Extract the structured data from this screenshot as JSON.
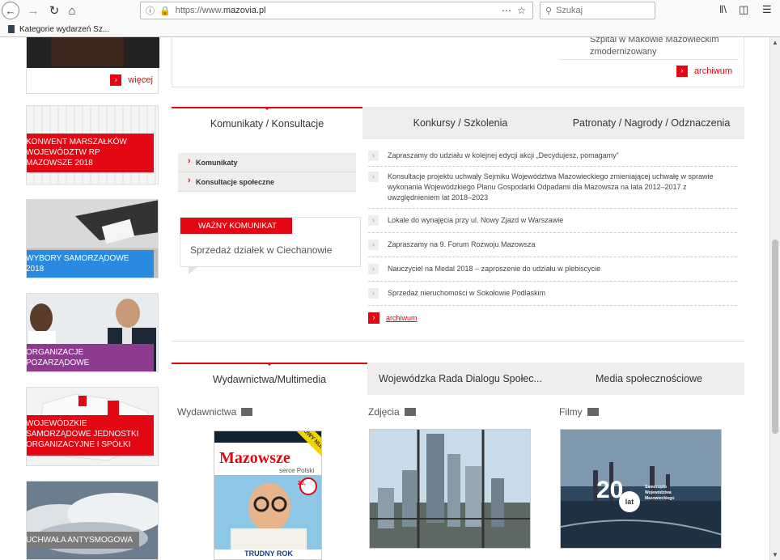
{
  "browser": {
    "url_proto": "https://www.",
    "url_host": "mazovia.pl",
    "search_placeholder": "Szukaj",
    "bookmark": "Kategorie wydarzeń Sz..."
  },
  "top": {
    "more_label": "więcej",
    "news_tail": "Szpital w Makowie Mazowieckim zmodernizowany",
    "archive_label": "archiwum"
  },
  "left_tiles": [
    {
      "label": "KONWENT MARSZAŁKÓW WOJEWÓDZTW RP MAZOWSZE 2018"
    },
    {
      "label": "WYBORY SAMORZĄDOWE 2018"
    },
    {
      "label": "ORGANIZACJE POZARZĄDOWE"
    },
    {
      "label": "WOJEWÓDZKIE SAMORZĄDOWE JEDNOSTKI ORGANIZACYJNE I SPÓŁKI"
    },
    {
      "label": "UCHWAŁA ANTYSMOGOWA"
    }
  ],
  "komunikaty": {
    "tabs": [
      "Komunikaty / Konsultacje",
      "Konkursy / Szkolenia",
      "Patronaty / Nagrody / Odznaczenia"
    ],
    "sub_links": [
      "Komunikaty",
      "Konsultacje społeczne"
    ],
    "important_badge": "WAŻNY KOMUNIKAT",
    "important_text": "Sprzedaż działek w Ciechanowie",
    "news": [
      "Zapraszamy do udziału w kolejnej edycji akcji „Decydujesz, pomagamy”",
      "Konsultacje projektu uchwały Sejmiku Województwa Mazowieckiego zmieniającej uchwałę w sprawie wykonania Wojewódzkiego Planu Gospodarki Odpadami dla Mazowsza na lata 2012–2017 z uwzględnieniem lat 2018–2023",
      "Lokale do wynajęcia przy ul. Nowy Zjazd w Warszawie",
      "Zapraszamy na 9. Forum Rozwoju Mazowsza",
      "Nauczyciel na Medal 2018 – zaproszenie do udziału w plebiscycie",
      "Sprzedaż nieruchomości w Sokołowie Podlaskim"
    ],
    "archive_label": "archiwum"
  },
  "multimedia": {
    "tabs": [
      "Wydawnictwa/Multimedia",
      "Wojewódzka Rada Dialogu Społec...",
      "Media społecznościowe"
    ],
    "col_titles": [
      "Wydawnictwa",
      "Zdjęcia",
      "Filmy"
    ],
    "magazine_title": "Mazowsze",
    "magazine_sub": "serce Polski",
    "magazine_badge": "NOWY NUMER",
    "magazine_headline": "TRUDNY ROK",
    "magazine_20": "20.",
    "film_logo_20": "20.",
    "film_logo_lat": "lat",
    "film_logo_text": "Samorządu Województwa Mazowieckiego"
  }
}
